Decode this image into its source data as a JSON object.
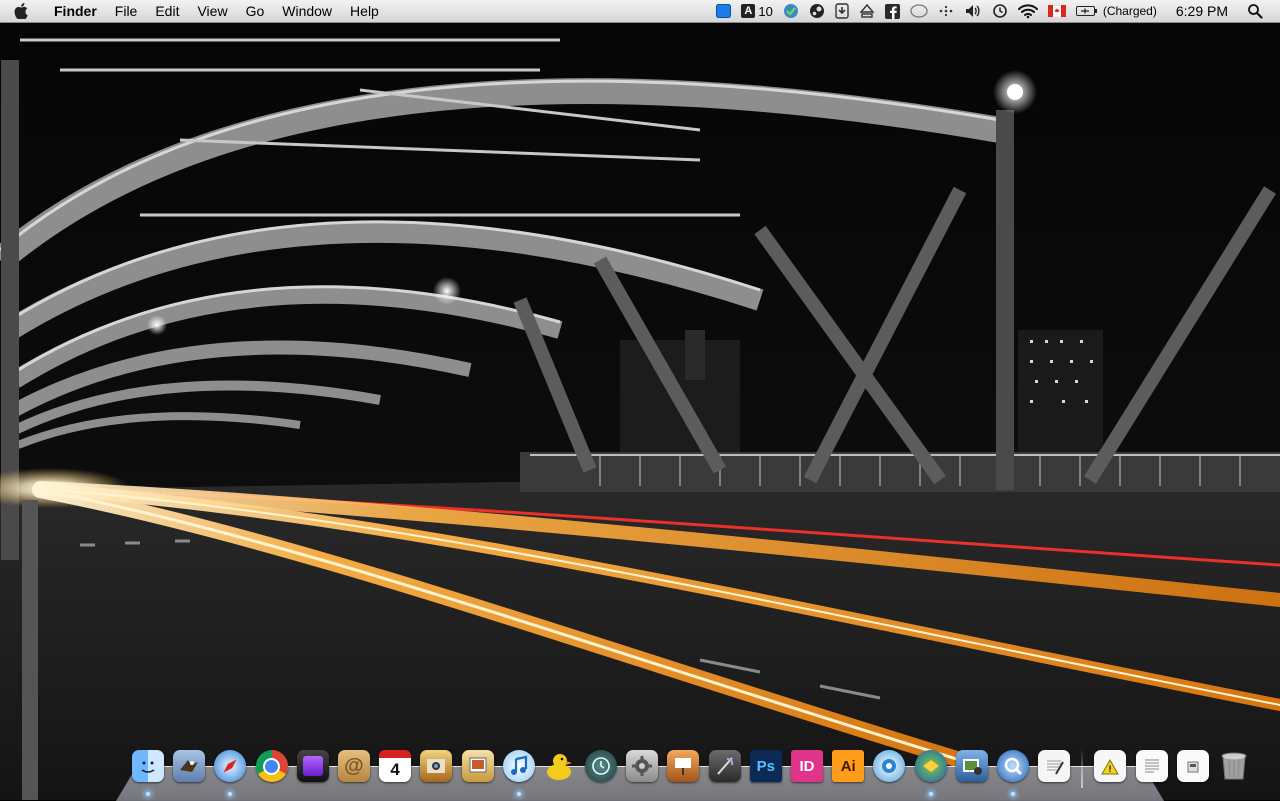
{
  "menubar": {
    "app_name": "Finder",
    "menus": [
      "File",
      "Edit",
      "View",
      "Go",
      "Window",
      "Help"
    ],
    "status": {
      "font_size": "10",
      "battery": "(Charged)",
      "clock": "6:29 PM"
    },
    "extras": [
      "blue-square-icon",
      "text-a-icon",
      "evernote-icon",
      "steam-icon",
      "download-icon",
      "eject-icon",
      "facebook-icon",
      "oval-icon",
      "dots-icon",
      "volume-icon",
      "time-machine-icon",
      "wifi-icon",
      "canada-flag-icon",
      "battery-icon",
      "spotlight-icon"
    ]
  },
  "dock": {
    "apps": [
      {
        "name": "finder-icon",
        "running": true
      },
      {
        "name": "mail-eagle-icon",
        "running": false
      },
      {
        "name": "safari-icon",
        "running": true
      },
      {
        "name": "chrome-icon",
        "running": false
      },
      {
        "name": "purple-app-icon",
        "running": false
      },
      {
        "name": "address-book-icon",
        "running": false
      },
      {
        "name": "ical-icon",
        "running": false,
        "label": "4"
      },
      {
        "name": "iphoto-icon",
        "running": false
      },
      {
        "name": "preview-icon",
        "running": false
      },
      {
        "name": "itunes-icon",
        "running": true
      },
      {
        "name": "cyberduck-icon",
        "running": false
      },
      {
        "name": "time-machine-icon",
        "running": false
      },
      {
        "name": "system-preferences-icon",
        "running": false
      },
      {
        "name": "keynote-icon",
        "running": false
      },
      {
        "name": "quill-app-icon",
        "running": false
      },
      {
        "name": "photoshop-icon",
        "running": false,
        "label": "Ps"
      },
      {
        "name": "indesign-icon",
        "running": false,
        "label": "ID"
      },
      {
        "name": "illustrator-icon",
        "running": false,
        "label": "Ai"
      },
      {
        "name": "globe-app-icon",
        "running": false
      },
      {
        "name": "disc-app-icon",
        "running": true
      },
      {
        "name": "image-capture-icon",
        "running": false
      },
      {
        "name": "quicktime-icon",
        "running": true
      },
      {
        "name": "textedit-icon",
        "running": false
      }
    ],
    "stacks": [
      {
        "name": "warning-document-icon"
      },
      {
        "name": "document-stack-icon"
      },
      {
        "name": "downloads-stack-icon"
      },
      {
        "name": "trash-icon"
      }
    ]
  }
}
